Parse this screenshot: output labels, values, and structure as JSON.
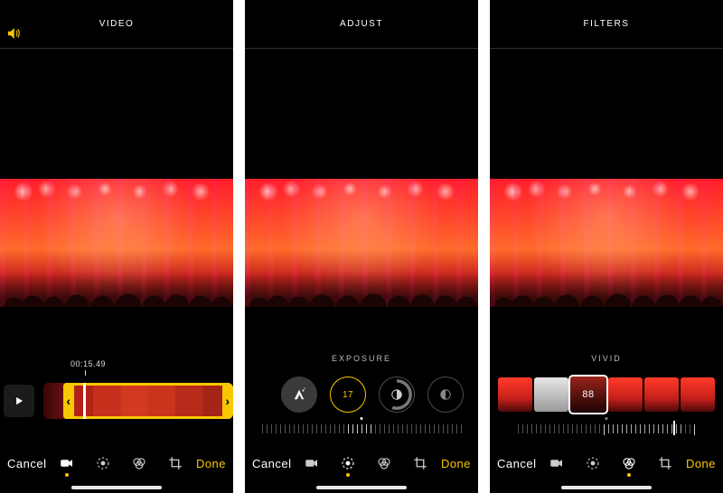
{
  "screens": [
    {
      "title": "VIDEO",
      "sound_on": true,
      "timestamp": "00:15.49",
      "cancel_label": "Cancel",
      "done_label": "Done",
      "active_mode": "video"
    },
    {
      "title": "ADJUST",
      "adjust_name": "EXPOSURE",
      "adjust_value": "17",
      "cancel_label": "Cancel",
      "done_label": "Done",
      "active_mode": "adjust"
    },
    {
      "title": "FILTERS",
      "filter_name": "VIVID",
      "filter_strength": "88",
      "cancel_label": "Cancel",
      "done_label": "Done",
      "active_mode": "filters"
    }
  ],
  "modes": [
    "video",
    "adjust",
    "filters",
    "crop"
  ],
  "colors": {
    "accent": "#fac800",
    "text": "#ffffff"
  }
}
